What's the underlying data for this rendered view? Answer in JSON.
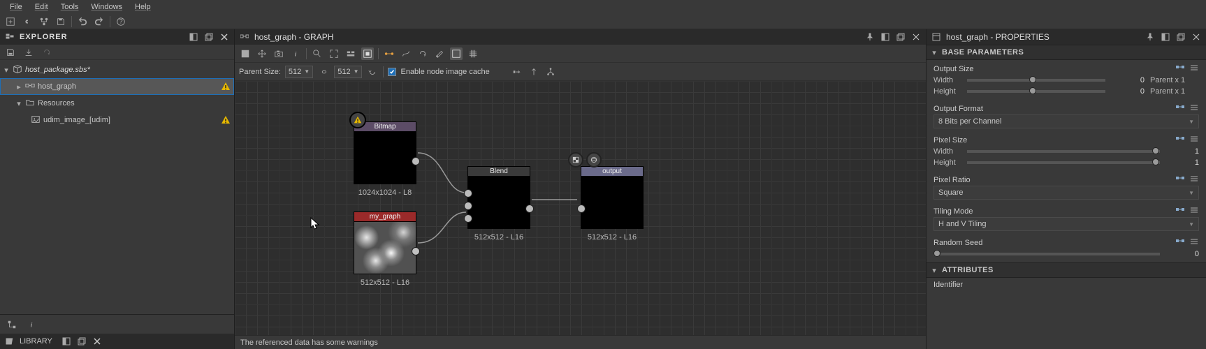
{
  "menu": {
    "file": "File",
    "edit": "Edit",
    "tools": "Tools",
    "windows": "Windows",
    "help": "Help"
  },
  "explorer": {
    "title": "EXPLORER",
    "package": "host_package.sbs*",
    "items": [
      {
        "label": "host_graph",
        "warn": true,
        "selected": true
      },
      {
        "label": "Resources",
        "warn": false
      },
      {
        "label": "udim_image_[udim]",
        "warn": true
      }
    ],
    "library_title": "LIBRARY"
  },
  "graph": {
    "tab_title": "host_graph - GRAPH",
    "parent_size_label": "Parent Size:",
    "parent_size_value": "512",
    "size_value": "512",
    "cache_label": "Enable node image cache",
    "nodes": {
      "bitmap": {
        "title": "Bitmap",
        "footer": "1024x1024 - L8"
      },
      "mygraph": {
        "title": "my_graph",
        "footer": "512x512 - L16"
      },
      "blend": {
        "title": "Blend",
        "footer": "512x512 - L16"
      },
      "output": {
        "title": "output",
        "footer": "512x512 - L16"
      }
    },
    "status": "The referenced data has some warnings"
  },
  "props": {
    "tab_title": "host_graph - PROPERTIES",
    "base_section": "BASE PARAMETERS",
    "attrs_section": "ATTRIBUTES",
    "output_size": {
      "label": "Output Size",
      "width_label": "Width",
      "height_label": "Height",
      "width_val": "0",
      "height_val": "0",
      "width_extra": "Parent x 1",
      "height_extra": "Parent x 1"
    },
    "output_format": {
      "label": "Output Format",
      "value": "8 Bits per Channel"
    },
    "pixel_size": {
      "label": "Pixel Size",
      "width_label": "Width",
      "height_label": "Height",
      "width_val": "1",
      "height_val": "1"
    },
    "pixel_ratio": {
      "label": "Pixel Ratio",
      "value": "Square"
    },
    "tiling": {
      "label": "Tiling Mode",
      "value": "H and V Tiling"
    },
    "seed": {
      "label": "Random Seed",
      "value": "0"
    },
    "identifier": {
      "label": "Identifier"
    }
  }
}
